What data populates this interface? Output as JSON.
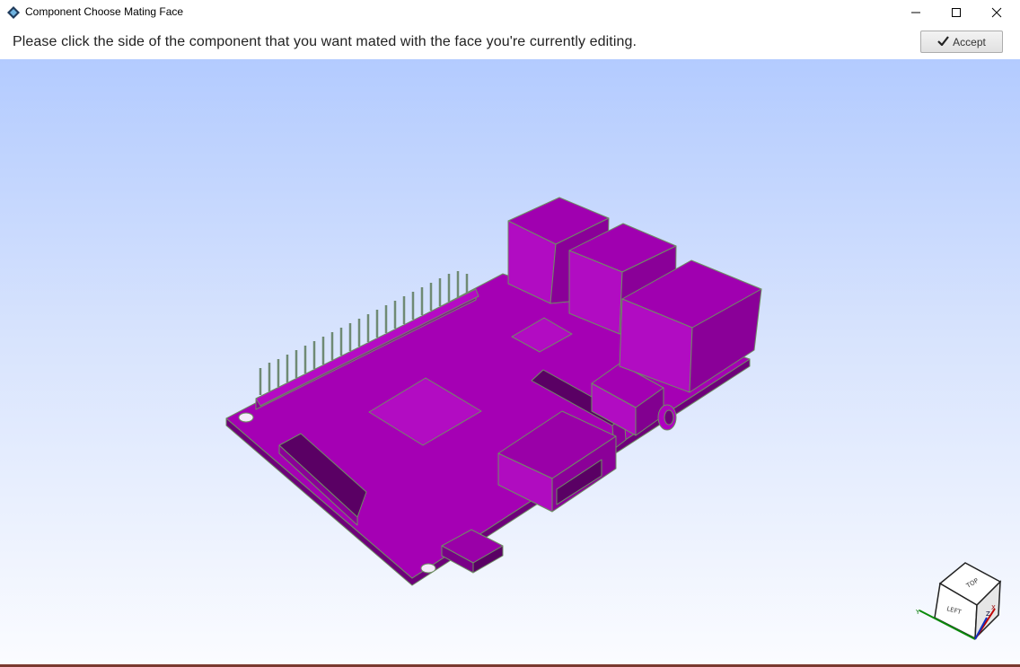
{
  "window": {
    "title": "Component Choose Mating Face",
    "app_icon": "diamond-app-icon",
    "controls": [
      "minimize-icon",
      "maximize-icon",
      "close-icon"
    ]
  },
  "instruction": {
    "text": "Please click the side of the component that you want mated with the face you're currently editing."
  },
  "accept_button": {
    "label": "Accept",
    "icon": "checkmark-icon"
  },
  "viewport": {
    "background_top": "#b3cbff",
    "background_bottom": "#fbfcff",
    "model_color": "#a200b0",
    "edge_color": "#7b9a6e"
  },
  "view_cube": {
    "top_face_label": "TOP",
    "left_face_label": "LEFT",
    "axes": [
      "X",
      "Y",
      "Z"
    ]
  }
}
